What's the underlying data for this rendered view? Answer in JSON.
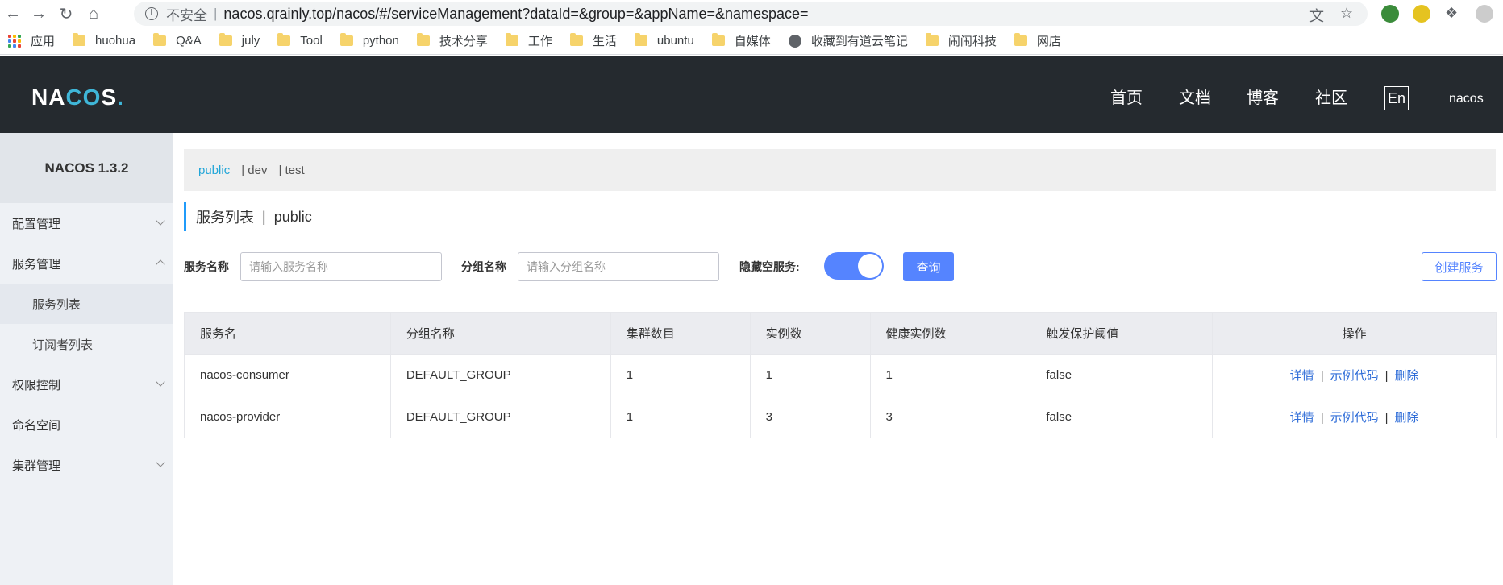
{
  "browser": {
    "insecure_label": "不安全",
    "url": "nacos.qrainly.top/nacos/#/serviceManagement?dataId=&group=&appName=&namespace=",
    "bookmarks": [
      {
        "label": "应用",
        "icon": "apps-grid-icon"
      },
      {
        "label": "huohua",
        "icon": "folder-icon"
      },
      {
        "label": "Q&A",
        "icon": "folder-icon"
      },
      {
        "label": "july",
        "icon": "folder-icon"
      },
      {
        "label": "Tool",
        "icon": "folder-icon"
      },
      {
        "label": "python",
        "icon": "folder-icon"
      },
      {
        "label": "技术分享",
        "icon": "folder-icon"
      },
      {
        "label": "工作",
        "icon": "folder-icon"
      },
      {
        "label": "生活",
        "icon": "folder-icon"
      },
      {
        "label": "ubuntu",
        "icon": "folder-icon"
      },
      {
        "label": "自媒体",
        "icon": "folder-icon"
      },
      {
        "label": "收藏到有道云笔记",
        "icon": "globe-icon"
      },
      {
        "label": "闹闹科技",
        "icon": "folder-icon"
      },
      {
        "label": "网店",
        "icon": "folder-icon"
      }
    ]
  },
  "header": {
    "logo_pre": "NA",
    "logo_mid": "CO",
    "logo_post": "S",
    "logo_dot": ".",
    "nav": [
      "首页",
      "文档",
      "博客",
      "社区"
    ],
    "lang": "En",
    "user": "nacos"
  },
  "sidebar": {
    "version": "NACOS 1.3.2",
    "items": [
      {
        "label": "配置管理"
      },
      {
        "label": "服务管理"
      },
      {
        "label": "服务列表"
      },
      {
        "label": "订阅者列表"
      },
      {
        "label": "权限控制"
      },
      {
        "label": "命名空间"
      },
      {
        "label": "集群管理"
      }
    ]
  },
  "namespaces": {
    "items": [
      "public",
      "| dev",
      "| test"
    ]
  },
  "page": {
    "title": "服务列表",
    "pipe": "|",
    "namespace": "public"
  },
  "filters": {
    "service_label": "服务名称",
    "service_placeholder": "请输入服务名称",
    "group_label": "分组名称",
    "group_placeholder": "请输入分组名称",
    "hide_empty_label": "隐藏空服务:",
    "hide_empty_on": true,
    "query_button": "查询",
    "create_button": "创建服务"
  },
  "table": {
    "headers": [
      "服务名",
      "分组名称",
      "集群数目",
      "实例数",
      "健康实例数",
      "触发保护阈值",
      "操作"
    ],
    "rows": [
      [
        "nacos-consumer",
        "DEFAULT_GROUP",
        "1",
        "1",
        "1",
        "false"
      ],
      [
        "nacos-provider",
        "DEFAULT_GROUP",
        "1",
        "3",
        "3",
        "false"
      ]
    ],
    "actions": [
      "详情",
      "示例代码",
      "删除"
    ],
    "action_sep": "|"
  },
  "colors": {
    "primary": "#5584ff",
    "header_bg": "#252a2f",
    "sidebar_bg": "#eef1f5",
    "link": "#2f6dd8"
  }
}
